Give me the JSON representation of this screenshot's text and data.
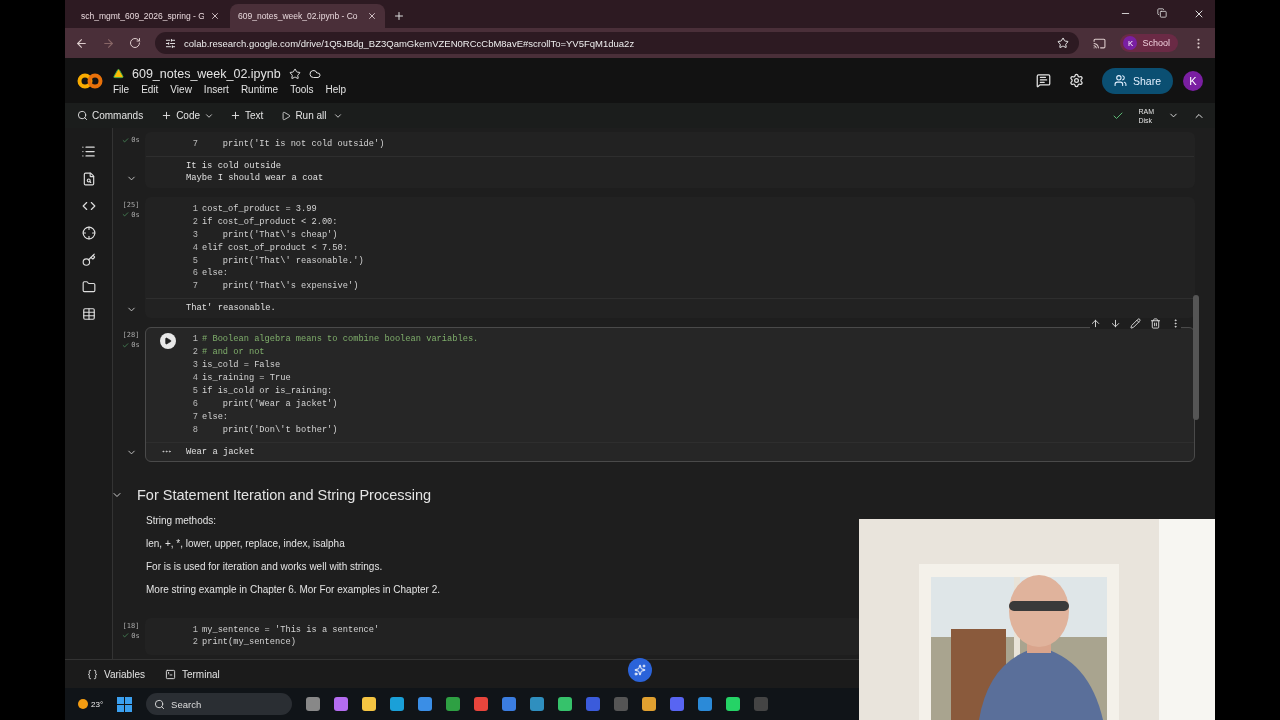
{
  "browser": {
    "tabs": [
      {
        "title": "sch_mgmt_609_2026_spring - G",
        "selected": false
      },
      {
        "title": "609_notes_week_02.ipynb - Co",
        "selected": true
      }
    ],
    "url": "colab.research.google.com/drive/1Q5JBdg_BZ3QamGkemVZEN0RCcCbM8avE#scrollTo=YV5FqM1dua2z",
    "profile_initial": "K",
    "profile_label": "School"
  },
  "notebook": {
    "title": "609_notes_week_02.ipynb",
    "menu": [
      "File",
      "Edit",
      "View",
      "Insert",
      "Runtime",
      "Tools",
      "Help"
    ],
    "share": "Share",
    "user_initial": "K"
  },
  "toolbar": {
    "commands": "Commands",
    "code": "Code",
    "text": "Text",
    "run_all": "Run all",
    "ram": "RAM",
    "disk": "Disk"
  },
  "cells": [
    {
      "kind": "code",
      "time": "0s",
      "focused": false,
      "lines": [
        {
          "n": "7",
          "kind": "code",
          "text": "    print('It is not cold outside')"
        }
      ],
      "output": [
        "It is cold outside",
        "Maybe I should wear a coat"
      ]
    },
    {
      "kind": "code",
      "count": "[25]",
      "time": "0s",
      "focused": false,
      "lines": [
        {
          "n": "1",
          "kind": "code",
          "text": "cost_of_product = 3.99"
        },
        {
          "n": "2",
          "kind": "code",
          "text": "if cost_of_product < 2.00:"
        },
        {
          "n": "3",
          "kind": "code",
          "text": "    print('That\\'s cheap')"
        },
        {
          "n": "4",
          "kind": "code",
          "text": "elif cost_of_product < 7.50:"
        },
        {
          "n": "5",
          "kind": "code",
          "text": "    print('That\\' reasonable.')"
        },
        {
          "n": "6",
          "kind": "code",
          "text": "else:"
        },
        {
          "n": "7",
          "kind": "code",
          "text": "    print('That\\'s expensive')"
        }
      ],
      "output": [
        "That' reasonable."
      ]
    },
    {
      "kind": "code",
      "count": "[28]",
      "time": "0s",
      "focused": true,
      "lines": [
        {
          "n": "1",
          "kind": "comment",
          "text": "# Boolean algebra means to combine boolean variables."
        },
        {
          "n": "2",
          "kind": "comment",
          "text": "# and or not"
        },
        {
          "n": "3",
          "kind": "code",
          "text": "is_cold = False"
        },
        {
          "n": "4",
          "kind": "code",
          "text": "is_raining = True"
        },
        {
          "n": "5",
          "kind": "code",
          "text": "if is_cold or is_raining:"
        },
        {
          "n": "6",
          "kind": "code",
          "text": "    print('Wear a jacket')"
        },
        {
          "n": "7",
          "kind": "code",
          "text": "else:"
        },
        {
          "n": "8",
          "kind": "code",
          "text": "    print('Don\\'t bother')"
        }
      ],
      "output": [
        "Wear a jacket"
      ]
    },
    {
      "kind": "text",
      "heading": "For Statement Iteration and String Processing",
      "paragraphs": [
        "String methods:",
        "len, +, *, lower, upper, replace, index, isalpha",
        "For is is used for iteration and works well with strings.",
        "More string example in Chapter 6. Mor For examples in Chapter 2."
      ]
    },
    {
      "kind": "code",
      "count": "[18]",
      "time": "0s",
      "focused": false,
      "lines": [
        {
          "n": "1",
          "kind": "code",
          "text": "my_sentence = 'This is a sentence'"
        },
        {
          "n": "2",
          "kind": "code",
          "text": "print(my_sentence)"
        }
      ]
    }
  ],
  "bottom": [
    "Variables",
    "Terminal"
  ],
  "taskbar": {
    "temperature": "23°",
    "search": "Search"
  }
}
